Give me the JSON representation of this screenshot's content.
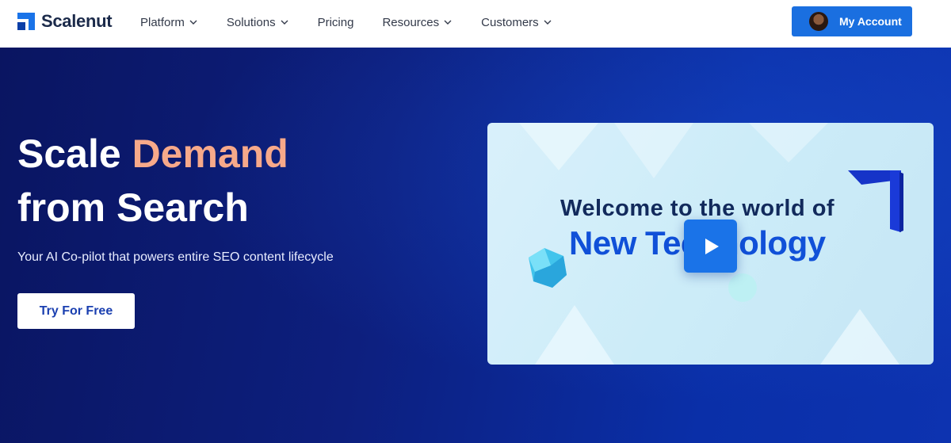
{
  "brand": {
    "name": "Scalenut"
  },
  "nav": {
    "items": [
      {
        "label": "Platform",
        "has_dropdown": true
      },
      {
        "label": "Solutions",
        "has_dropdown": true
      },
      {
        "label": "Pricing",
        "has_dropdown": false
      },
      {
        "label": "Resources",
        "has_dropdown": true
      },
      {
        "label": "Customers",
        "has_dropdown": true
      }
    ],
    "account_label": "My Account"
  },
  "hero": {
    "title_line1_plain": "Scale ",
    "title_line1_accent": "Demand",
    "title_line2": "from Search",
    "subtitle": "Your AI Co-pilot that powers entire SEO content lifecycle",
    "cta_label": "Try For Free"
  },
  "video": {
    "line1": "Welcome to the world of",
    "line2": "New Technology",
    "play_icon": "play-icon"
  },
  "colors": {
    "primary": "#1a6fe0",
    "accent": "#f7a98a",
    "hero_bg": "#0d1f7e"
  }
}
